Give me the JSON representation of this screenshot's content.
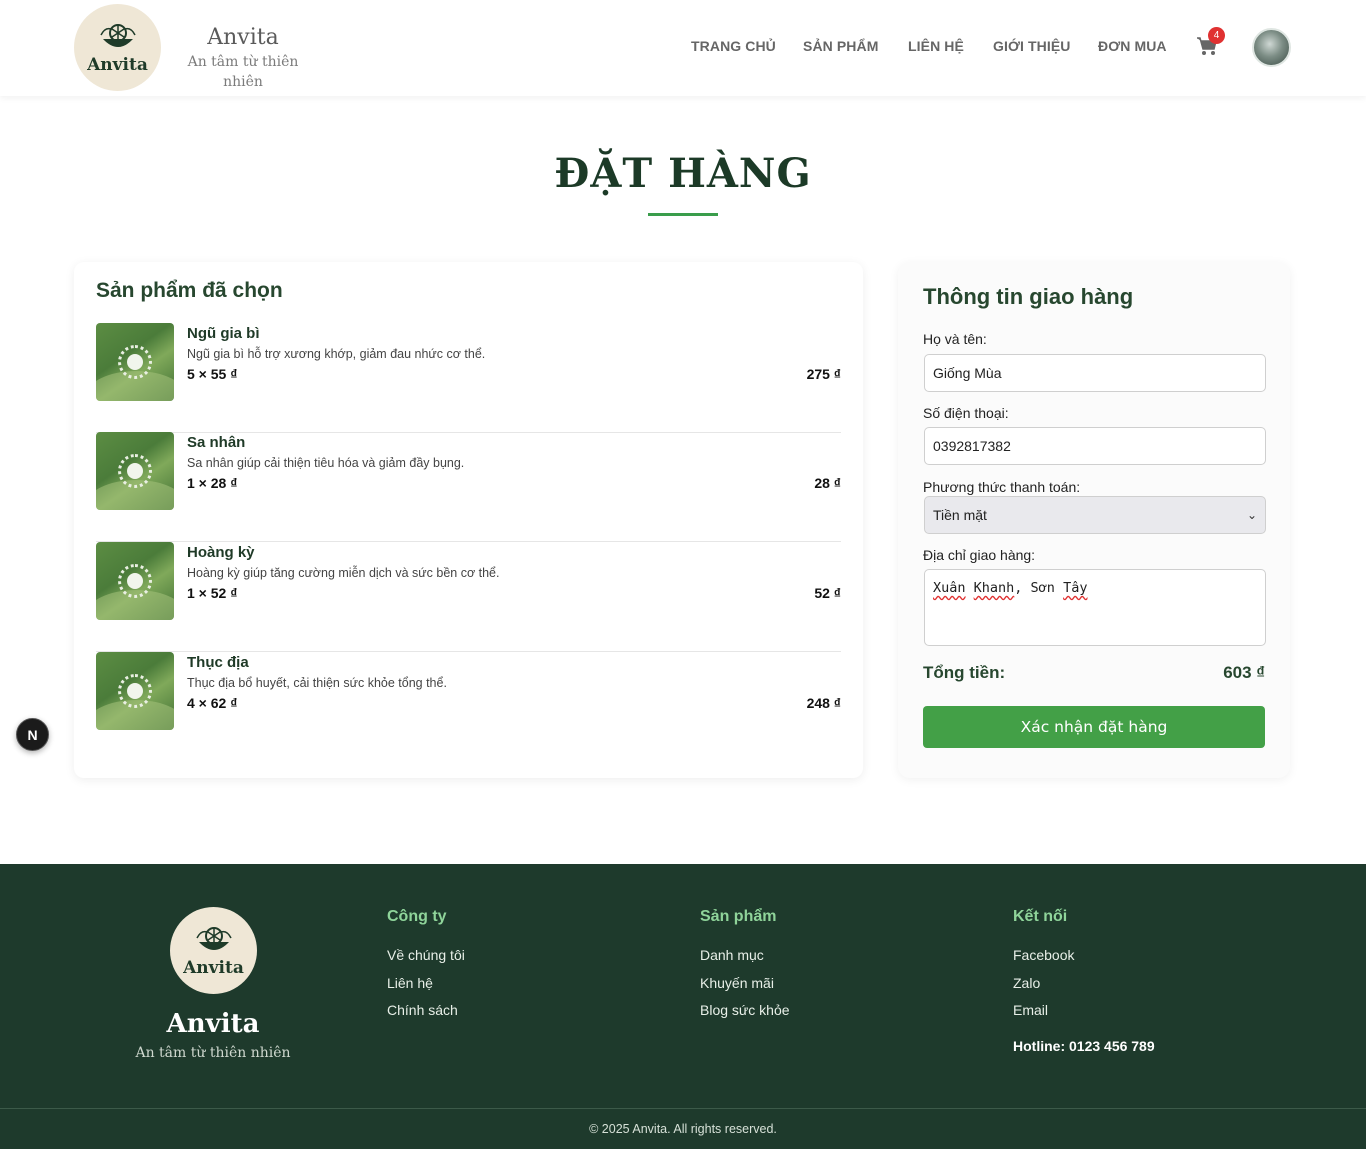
{
  "header": {
    "logo_text": "Anvita",
    "brand_name": "Anvita",
    "brand_tagline": "An tâm từ thiên nhiên",
    "nav": [
      {
        "label": "TRANG CHỦ"
      },
      {
        "label": "SẢN PHẨM"
      },
      {
        "label": "LIÊN HỆ"
      },
      {
        "label": "GIỚI THIỆU"
      },
      {
        "label": "ĐƠN MUA"
      }
    ],
    "cart_count": "4",
    "cart_icon": "shopping-cart-icon"
  },
  "page": {
    "title": "ĐẶT HÀNG"
  },
  "products_card": {
    "title": "Sản phẩm đã chọn",
    "items": [
      {
        "name": "Ngũ gia bì",
        "description": "Ngũ gia bì hỗ trợ xương khớp, giảm đau nhức cơ thể.",
        "qty_price": "5 × 55 ₫",
        "total": "275 ₫"
      },
      {
        "name": "Sa nhân",
        "description": "Sa nhân giúp cải thiện tiêu hóa và giảm đầy bụng.",
        "qty_price": "1 × 28 ₫",
        "total": "28 ₫"
      },
      {
        "name": "Hoàng kỳ",
        "description": "Hoàng kỳ giúp tăng cường miễn dịch và sức bền cơ thể.",
        "qty_price": "1 × 52 ₫",
        "total": "52 ₫"
      },
      {
        "name": "Thục địa",
        "description": "Thục địa bổ huyết, cải thiện sức khỏe tổng thể.",
        "qty_price": "4 × 62 ₫",
        "total": "248 ₫"
      }
    ]
  },
  "shipping": {
    "title": "Thông tin giao hàng",
    "name_label": "Họ và tên:",
    "name_value": "Giống Mùa",
    "phone_label": "Số điện thoại:",
    "phone_value": "0392817382",
    "payment_label": "Phương thức thanh toán:",
    "payment_value": "Tiền mặt",
    "address_label": "Địa chỉ giao hàng:",
    "address_value_1": "Xuân",
    "address_value_2": "Khanh",
    "address_value_3": ", Sơn ",
    "address_value_4": "Tây",
    "total_label": "Tổng tiền:",
    "total_value": "603 ₫",
    "confirm_label": "Xác nhận đặt hàng"
  },
  "floating_button": {
    "label": "N"
  },
  "footer": {
    "logo_text": "Anvita",
    "brand_name": "Anvita",
    "brand_tagline": "An tâm từ thiên nhiên",
    "company": {
      "title": "Công ty",
      "links": [
        "Về chúng tôi",
        "Liên hệ",
        "Chính sách"
      ]
    },
    "products": {
      "title": "Sản phẩm",
      "links": [
        "Danh mục",
        "Khuyến mãi",
        "Blog sức khỏe"
      ]
    },
    "connect": {
      "title": "Kết nối",
      "links": [
        "Facebook",
        "Zalo",
        "Email"
      ],
      "hotline": "Hotline: 0123 456 789"
    },
    "copyright": "© 2025 Anvita. All rights reserved."
  },
  "colors": {
    "brand_dark": "#1e3a2c",
    "accent_green": "#43a047",
    "badge_red": "#e03131"
  }
}
